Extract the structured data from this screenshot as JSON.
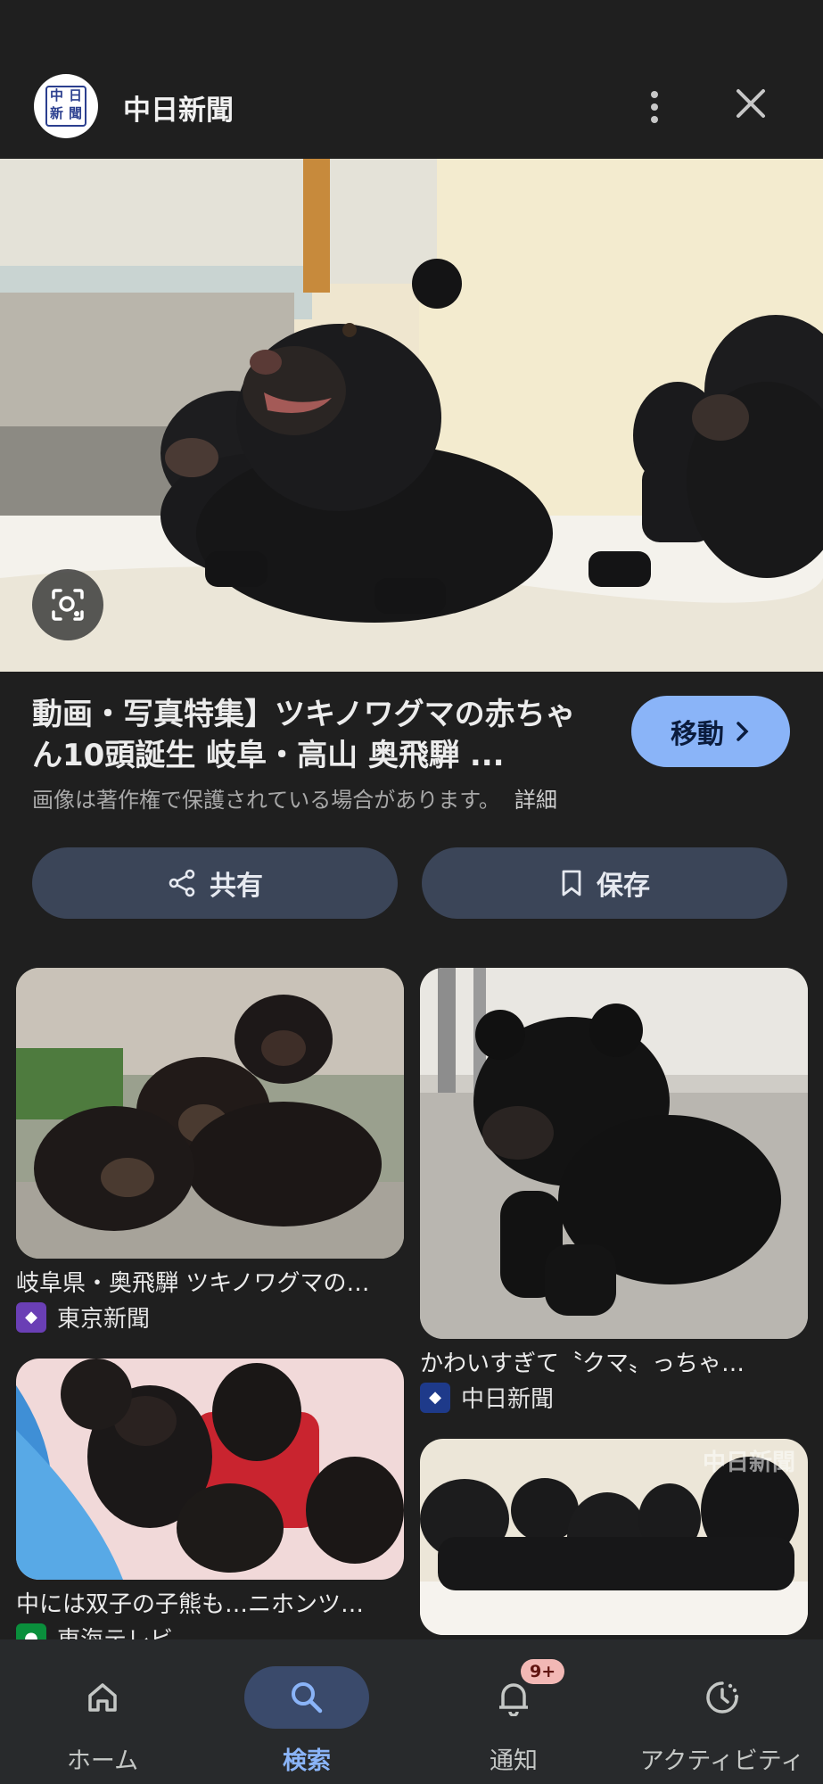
{
  "header": {
    "logo_chars": [
      "中",
      "日",
      "新",
      "聞"
    ],
    "source_name": "中日新聞",
    "more_icon": "more-vert-icon",
    "close_icon": "close-icon"
  },
  "result": {
    "title": "動画・写真特集】ツキノワグマの赤ちゃん10頭誕生 岐阜・高山 奥飛騨 ...",
    "copyright_note": "画像は著作権で保護されている場合があります。",
    "detail_link": "詳細",
    "visit_label": "移動",
    "share_label": "共有",
    "save_label": "保存"
  },
  "related": [
    {
      "caption": "岐阜県・奥飛騨 ツキノワグマの…",
      "source": "東京新聞",
      "fav_color": "#6a3fb5"
    },
    {
      "caption": "かわいすぎて〝クマ〟っちゃ…",
      "source": "中日新聞",
      "fav_color": "#1e3a8a"
    },
    {
      "caption": "中には双子の子熊も…ニホンツ…",
      "source": "東海テレビ",
      "fav_color": "#0a8f3c"
    },
    {
      "caption": "",
      "source": "",
      "watermark": "中日新聞"
    }
  ],
  "nav": {
    "items": [
      {
        "label": "ホーム",
        "icon": "home-icon"
      },
      {
        "label": "検索",
        "icon": "search-icon",
        "active": true
      },
      {
        "label": "通知",
        "icon": "bell-icon",
        "badge": "9+"
      },
      {
        "label": "アクティビティ",
        "icon": "activity-icon"
      }
    ]
  },
  "colors": {
    "background": "#1f1f1f",
    "accent": "#8ab4f8",
    "pill": "#3b4558",
    "nav_bg": "#282a2c"
  }
}
